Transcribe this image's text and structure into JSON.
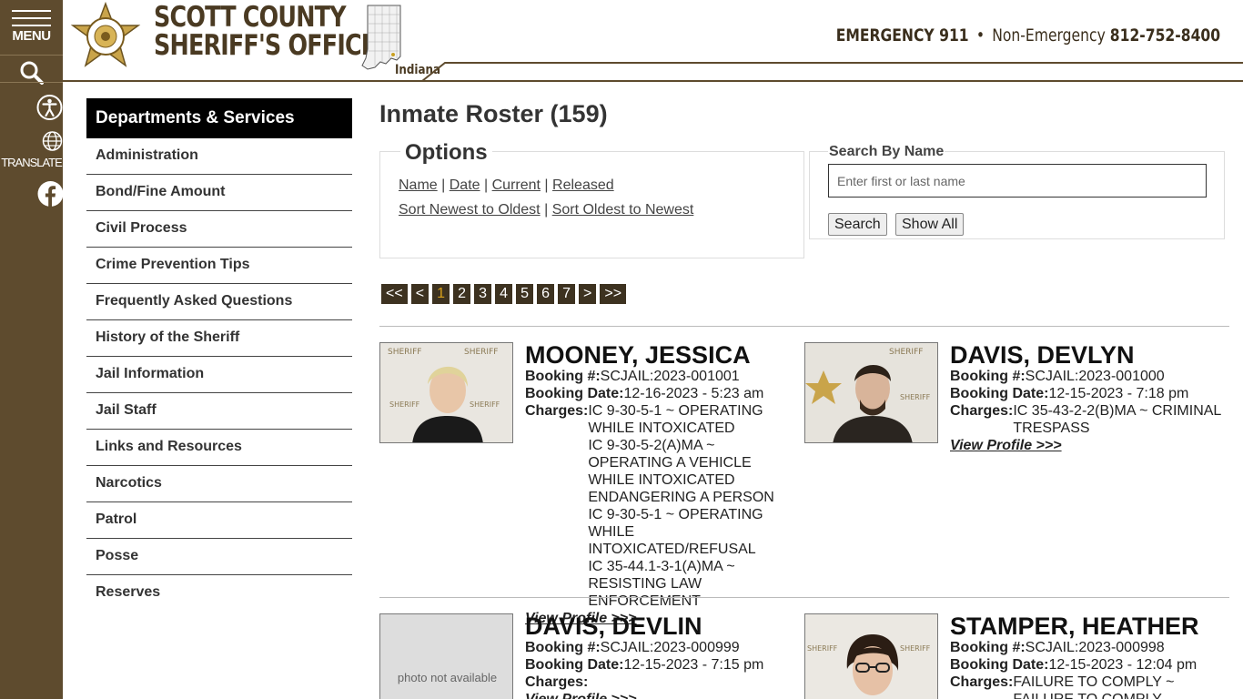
{
  "rail": {
    "menu_label": "MENU",
    "translate_label": "TRANSLATE"
  },
  "header": {
    "title_line1": "SCOTT COUNTY",
    "title_line2": "SHERIFF'S OFFICE",
    "state_label": "Indiana",
    "badge_text": "SCOTT COUNTY SHERIFF INDIANA",
    "emergency_label": "EMERGENCY 911",
    "separator": "•",
    "non_emergency_label": "Non-Emergency",
    "non_emergency_number": "812-752-8400"
  },
  "sidebar": {
    "heading": "Departments & Services",
    "items": [
      {
        "label": "Administration"
      },
      {
        "label": "Bond/Fine Amount"
      },
      {
        "label": "Civil Process"
      },
      {
        "label": "Crime Prevention Tips"
      },
      {
        "label": "Frequently Asked Questions"
      },
      {
        "label": "History of the Sheriff"
      },
      {
        "label": "Jail Information"
      },
      {
        "label": "Jail Staff"
      },
      {
        "label": "Links and Resources"
      },
      {
        "label": "Narcotics"
      },
      {
        "label": "Patrol"
      },
      {
        "label": "Posse"
      },
      {
        "label": "Reserves"
      }
    ]
  },
  "main": {
    "title": "Inmate Roster (159)",
    "options": {
      "title": "Options",
      "sort_links": [
        "Name",
        "Date",
        "Current",
        "Released"
      ],
      "order_links": [
        "Sort Newest to Oldest",
        "Sort Oldest to Newest"
      ],
      "divider": "|"
    },
    "search": {
      "label": "Search By Name",
      "placeholder": "Enter first or last name",
      "value": "",
      "search_button": "Search",
      "show_all_button": "Show All"
    },
    "pager": {
      "first": "<<",
      "prev": "<",
      "pages": [
        "1",
        "2",
        "3",
        "4",
        "5",
        "6",
        "7"
      ],
      "current": "1",
      "next": ">",
      "last": ">>"
    },
    "labels": {
      "booking_number": "Booking #:",
      "booking_date": "Booking Date:",
      "charges": "Charges:",
      "view_profile": "View Profile >>>",
      "photo_na": "photo not available"
    },
    "inmates": [
      {
        "name": "MOONEY, JESSICA",
        "booking_number": "SCJAIL:2023-001001",
        "booking_date": "12-16-2023 - 5:23 am",
        "charges": [
          "IC 9-30-5-1 ~ OPERATING WHILE INTOXICATED",
          "IC 9-30-5-2(A)MA ~ OPERATING A VEHICLE WHILE INTOXICATED ENDANGERING A PERSON",
          "IC 9-30-5-1 ~ OPERATING WHILE INTOXICATED/REFUSAL",
          "IC 35-44.1-3-1(A)MA ~ RESISTING LAW ENFORCEMENT"
        ],
        "photo": "photo"
      },
      {
        "name": "DAVIS, DEVLYN",
        "booking_number": "SCJAIL:2023-001000",
        "booking_date": "12-15-2023 - 7:18 pm",
        "charges": [
          "IC 35-43-2-2(B)MA ~ CRIMINAL TRESPASS"
        ],
        "photo": "photo"
      },
      {
        "name": "DAVIS, DEVLIN",
        "booking_number": "SCJAIL:2023-000999",
        "booking_date": "12-15-2023 - 7:15 pm",
        "charges": [],
        "photo": "none"
      },
      {
        "name": "STAMPER, HEATHER",
        "booking_number": "SCJAIL:2023-000998",
        "booking_date": "12-15-2023 - 12:04 pm",
        "charges": [
          "FAILURE TO COMPLY ~ FAILURE TO COMPLY"
        ],
        "photo": "photo"
      }
    ]
  },
  "colors": {
    "brand_brown": "#5e4b2e",
    "pager_bg": "#3d3220",
    "pager_current": "#d9a21b"
  }
}
